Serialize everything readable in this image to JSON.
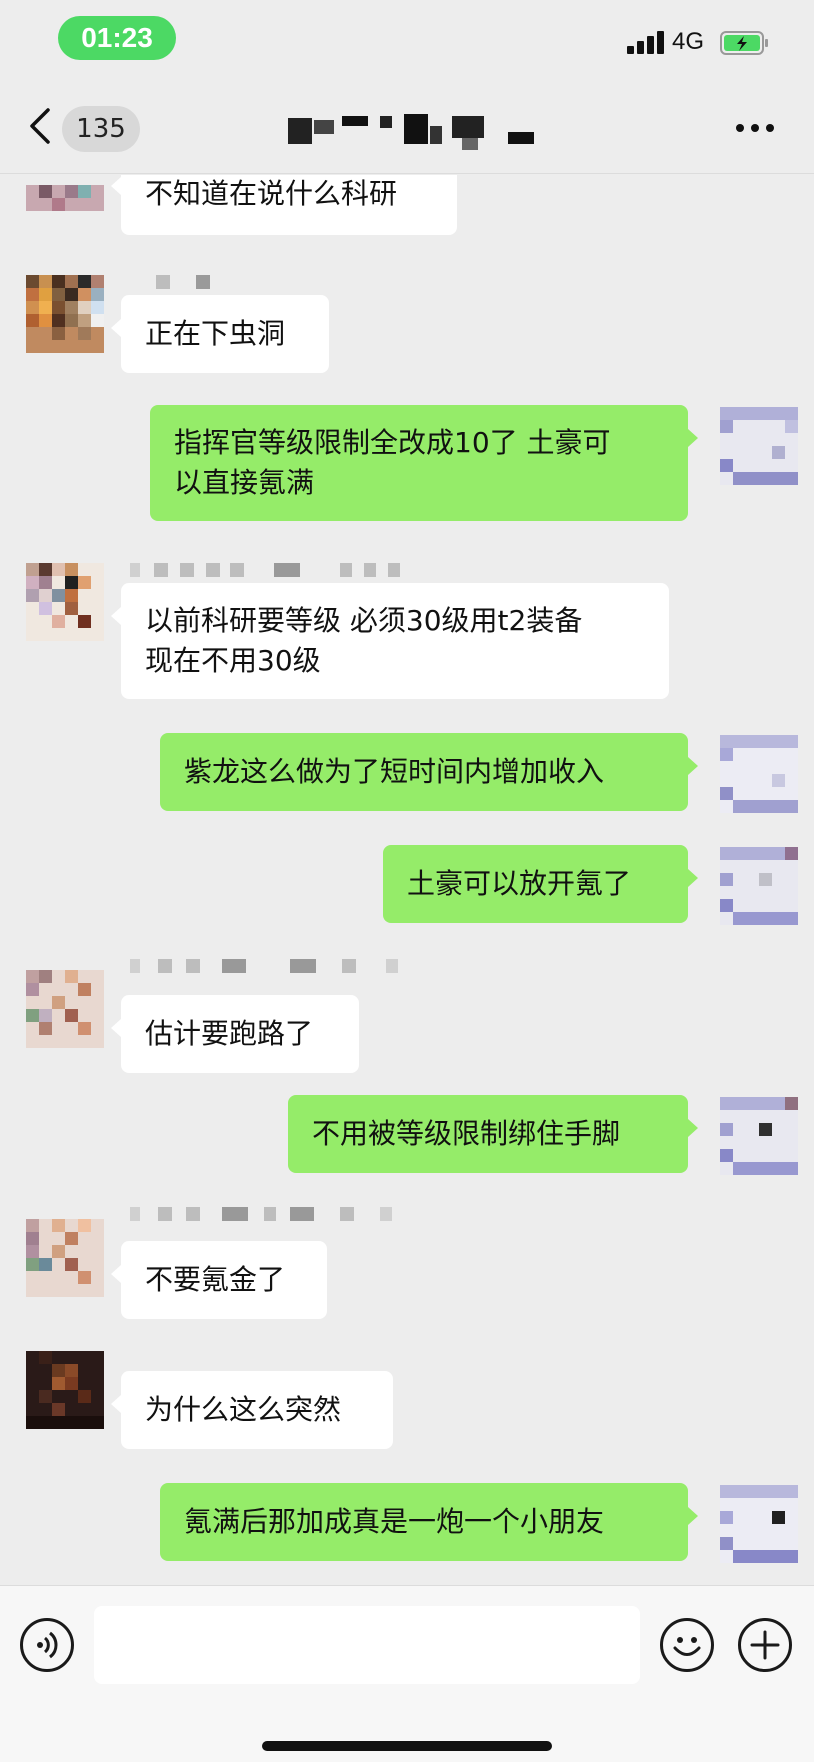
{
  "status_bar": {
    "time": "01:23",
    "network": "4G"
  },
  "nav": {
    "unread_count": "135",
    "title_blurred": true
  },
  "messages": [
    {
      "side": "left",
      "text": "不知道在说什么科研"
    },
    {
      "side": "left",
      "text": "正在下虫洞"
    },
    {
      "side": "right",
      "text": "指挥官等级限制全改成10了 土豪可\n以直接氪满"
    },
    {
      "side": "left",
      "text": "以前科研要等级 必须30级用t2装备\n现在不用30级"
    },
    {
      "side": "right",
      "text": "紫龙这么做为了短时间内增加收入"
    },
    {
      "side": "right",
      "text": "土豪可以放开氪了"
    },
    {
      "side": "left",
      "text": "估计要跑路了"
    },
    {
      "side": "right",
      "text": "不用被等级限制绑住手脚"
    },
    {
      "side": "left",
      "text": "不要氪金了"
    },
    {
      "side": "left",
      "text": "为什么这么突然"
    },
    {
      "side": "right",
      "text": "氪满后那加成真是一炮一个小朋友"
    }
  ],
  "input": {
    "value": ""
  },
  "colors": {
    "background": "#ededed",
    "outgoing_bubble": "#95ec69",
    "incoming_bubble": "#ffffff",
    "time_pill": "#4cd964"
  },
  "icons": [
    "back-icon",
    "more-icon",
    "voice-icon",
    "emoji-icon",
    "plus-icon",
    "signal-icon",
    "battery-icon"
  ]
}
